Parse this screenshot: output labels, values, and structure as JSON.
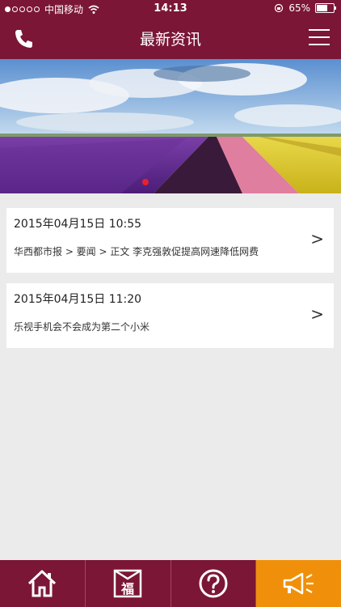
{
  "status_bar": {
    "carrier": "中国移动",
    "time": "14:13",
    "battery": "65%",
    "battery_level": 0.65,
    "signal_bars": 1
  },
  "navbar": {
    "title": "最新资讯",
    "left_icon": "phone-icon",
    "right_icon": "menu-icon"
  },
  "banner": {
    "image": "tulip field",
    "active_slide": 1
  },
  "news": [
    {
      "date": "2015年04月15日 10:55",
      "headline": "华西都市报 > 要闻 > 正文 李克强敦促提高网速降低网费",
      "arrow": ">"
    },
    {
      "date": "2015年04月15日 11:20",
      "headline": "乐视手机会不会成为第二个小米",
      "arrow": ">"
    }
  ],
  "tabbar": {
    "tabs": [
      {
        "icon": "home-icon",
        "active": false
      },
      {
        "icon": "fu-icon",
        "label": "福",
        "active": false
      },
      {
        "icon": "help-icon",
        "active": false
      },
      {
        "icon": "megaphone-icon",
        "active": true
      }
    ]
  },
  "colors": {
    "brand": "#7b1636",
    "active_tab": "#f0900a",
    "background": "#ebebeb",
    "slide_indicator": "#e8222c"
  }
}
